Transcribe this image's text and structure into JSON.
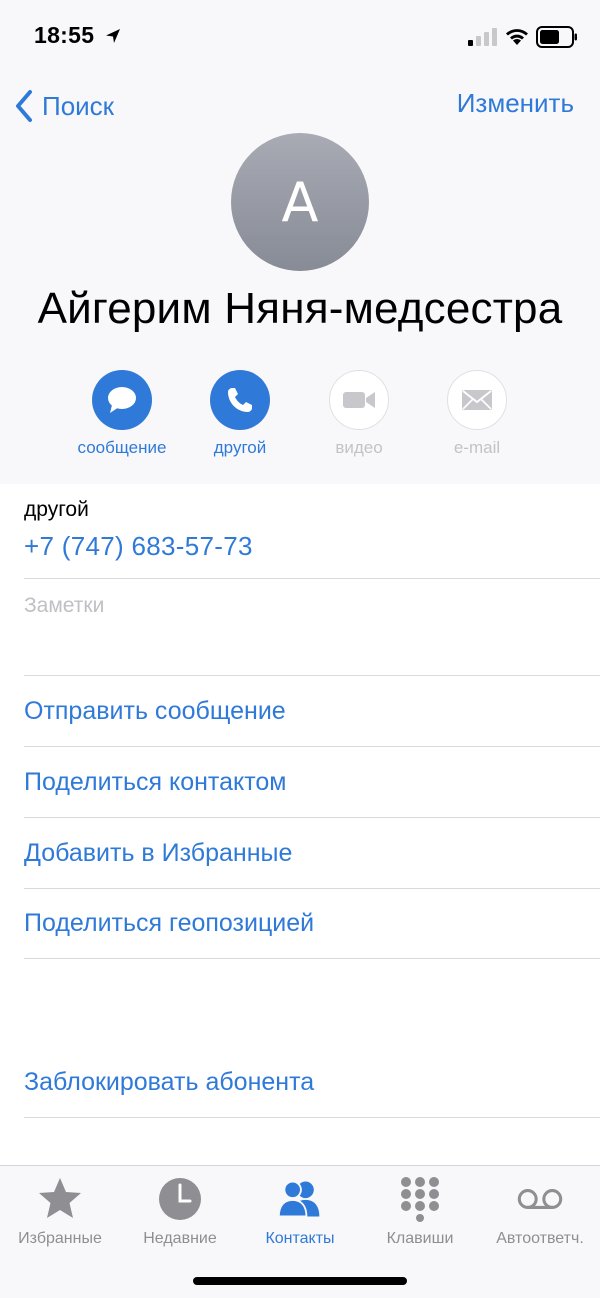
{
  "status_bar": {
    "time": "18:55"
  },
  "nav": {
    "back_label": "Поиск",
    "edit_label": "Изменить"
  },
  "contact": {
    "initial": "А",
    "name": "Айгерим Няня-медсестра"
  },
  "actions": [
    {
      "label": "сообщение",
      "icon": "message-icon",
      "enabled": true
    },
    {
      "label": "другой",
      "icon": "phone-icon",
      "enabled": true
    },
    {
      "label": "видео",
      "icon": "video-icon",
      "enabled": false
    },
    {
      "label": "e-mail",
      "icon": "mail-icon",
      "enabled": false
    }
  ],
  "phone": {
    "type": "другой",
    "number": "+7 (747) 683-57-73"
  },
  "notes": {
    "placeholder": "Заметки"
  },
  "links": {
    "send_message": "Отправить сообщение",
    "share_contact": "Поделиться контактом",
    "add_favorites": "Добавить в Избранные",
    "share_location": "Поделиться геопозицией",
    "block_caller": "Заблокировать абонента"
  },
  "tabs": [
    {
      "label": "Избранные",
      "icon": "star-icon",
      "active": false
    },
    {
      "label": "Недавние",
      "icon": "clock-icon",
      "active": false
    },
    {
      "label": "Контакты",
      "icon": "contacts-icon",
      "active": true
    },
    {
      "label": "Клавиши",
      "icon": "keypad-icon",
      "active": false
    },
    {
      "label": "Автоответч.",
      "icon": "voicemail-icon",
      "active": false
    }
  ],
  "colors": {
    "accent": "#2f7ad8",
    "inactive": "#8e8e93",
    "disabled": "#c3c3c7"
  }
}
